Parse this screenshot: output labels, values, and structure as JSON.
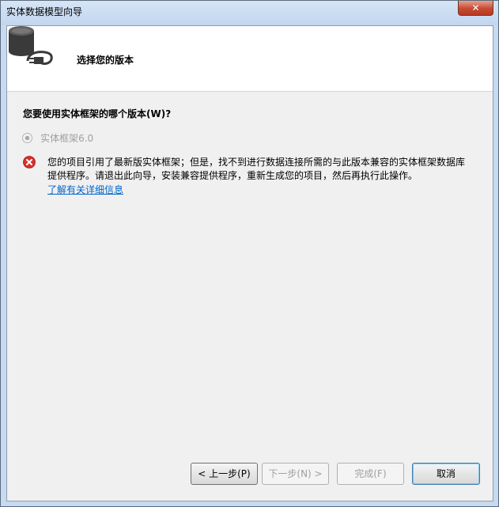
{
  "window": {
    "title": "实体数据模型向导",
    "close_glyph": "✕"
  },
  "header": {
    "title": "选择您的版本",
    "icon": "database-plug-icon"
  },
  "question": {
    "label": "您要使用实体框架的哪个版本(W)?"
  },
  "options": [
    {
      "label": "实体框架6.0",
      "selected": true,
      "disabled": true
    }
  ],
  "error": {
    "icon": "error-icon",
    "line1": "您的项目引用了最新版实体框架；但是，找不到进行数据连接所需的与此版本兼容的实体框架数据库",
    "line2": "提供程序。请退出此向导，安装兼容提供程序，重新生成您的项目，然后再执行此操作。",
    "link": "了解有关详细信息"
  },
  "buttons": {
    "back": "< 上一步(P)",
    "next": "下一步(N) >",
    "finish": "完成(F)",
    "cancel": "取消"
  }
}
